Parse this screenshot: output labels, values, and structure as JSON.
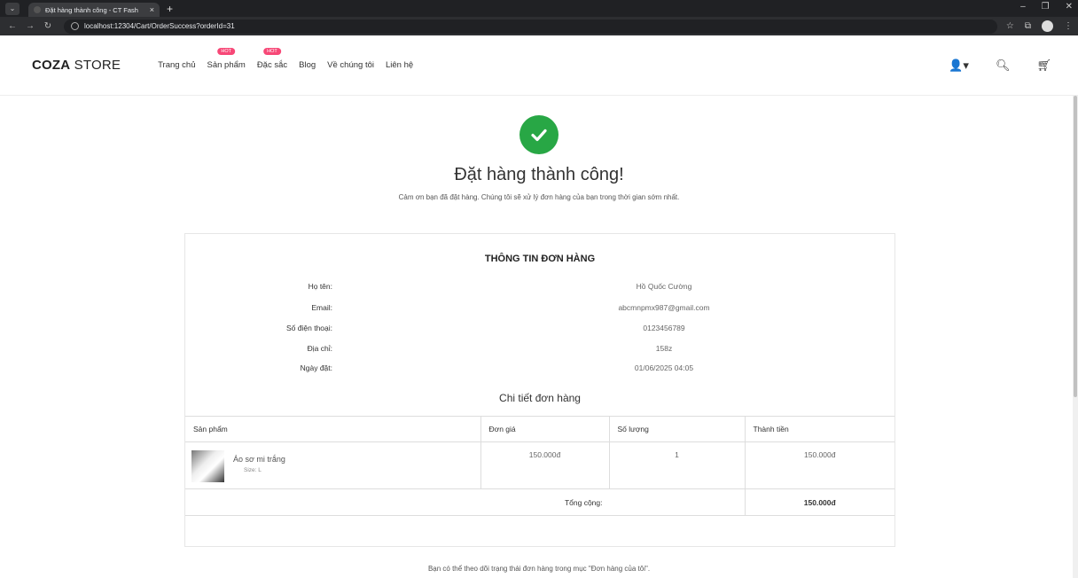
{
  "browser": {
    "tab_title": "Đặt hàng thành công - CT Fash",
    "tab_close": "×",
    "new_tab": "+",
    "url": "localhost:12304/Cart/OrderSuccess?orderId=31"
  },
  "header": {
    "logo_bold": "COZA",
    "logo_rest": " STORE",
    "nav": [
      {
        "label": "Trang chủ",
        "badge": ""
      },
      {
        "label": "Sản phẩm",
        "badge": "HOT"
      },
      {
        "label": "Đặc sắc",
        "badge": "HOT"
      },
      {
        "label": "Blog",
        "badge": ""
      },
      {
        "label": "Về chúng tôi",
        "badge": ""
      },
      {
        "label": "Liên hệ",
        "badge": ""
      }
    ]
  },
  "success": {
    "heading": "Đặt hàng thành công!",
    "subtext": "Cảm ơn bạn đã đặt hàng. Chúng tôi sẽ xử lý đơn hàng của bạn trong thời gian sớm nhất."
  },
  "order_info": {
    "title": "THÔNG TIN ĐƠN HÀNG",
    "rows": [
      {
        "label": "Họ tên:",
        "value": "Hồ Quốc Cường"
      },
      {
        "label": "Email:",
        "value": "abcmnpmx987@gmail.com"
      },
      {
        "label": "Số điện thoại:",
        "value": "0123456789"
      },
      {
        "label": "Địa chỉ:",
        "value": "158z"
      },
      {
        "label": "Ngày đặt:",
        "value": "01/06/2025 04:05"
      }
    ]
  },
  "order_detail": {
    "title": "Chi tiết đơn hàng",
    "columns": [
      "Sản phẩm",
      "Đơn giá",
      "Số lượng",
      "Thành tiền"
    ],
    "items": [
      {
        "name": "Áo sơ mi trắng",
        "size": "Size: L",
        "price": "150.000đ",
        "qty": "1",
        "subtotal": "150.000đ"
      }
    ],
    "total_label": "Tổng cộng:",
    "total_value": "150.000đ"
  },
  "footer_note": "Bạn có thể theo dõi trạng thái đơn hàng trong mục \"Đơn hàng của tôi\".",
  "colors": {
    "success": "#28a745",
    "hot_badge": "#f74877"
  }
}
